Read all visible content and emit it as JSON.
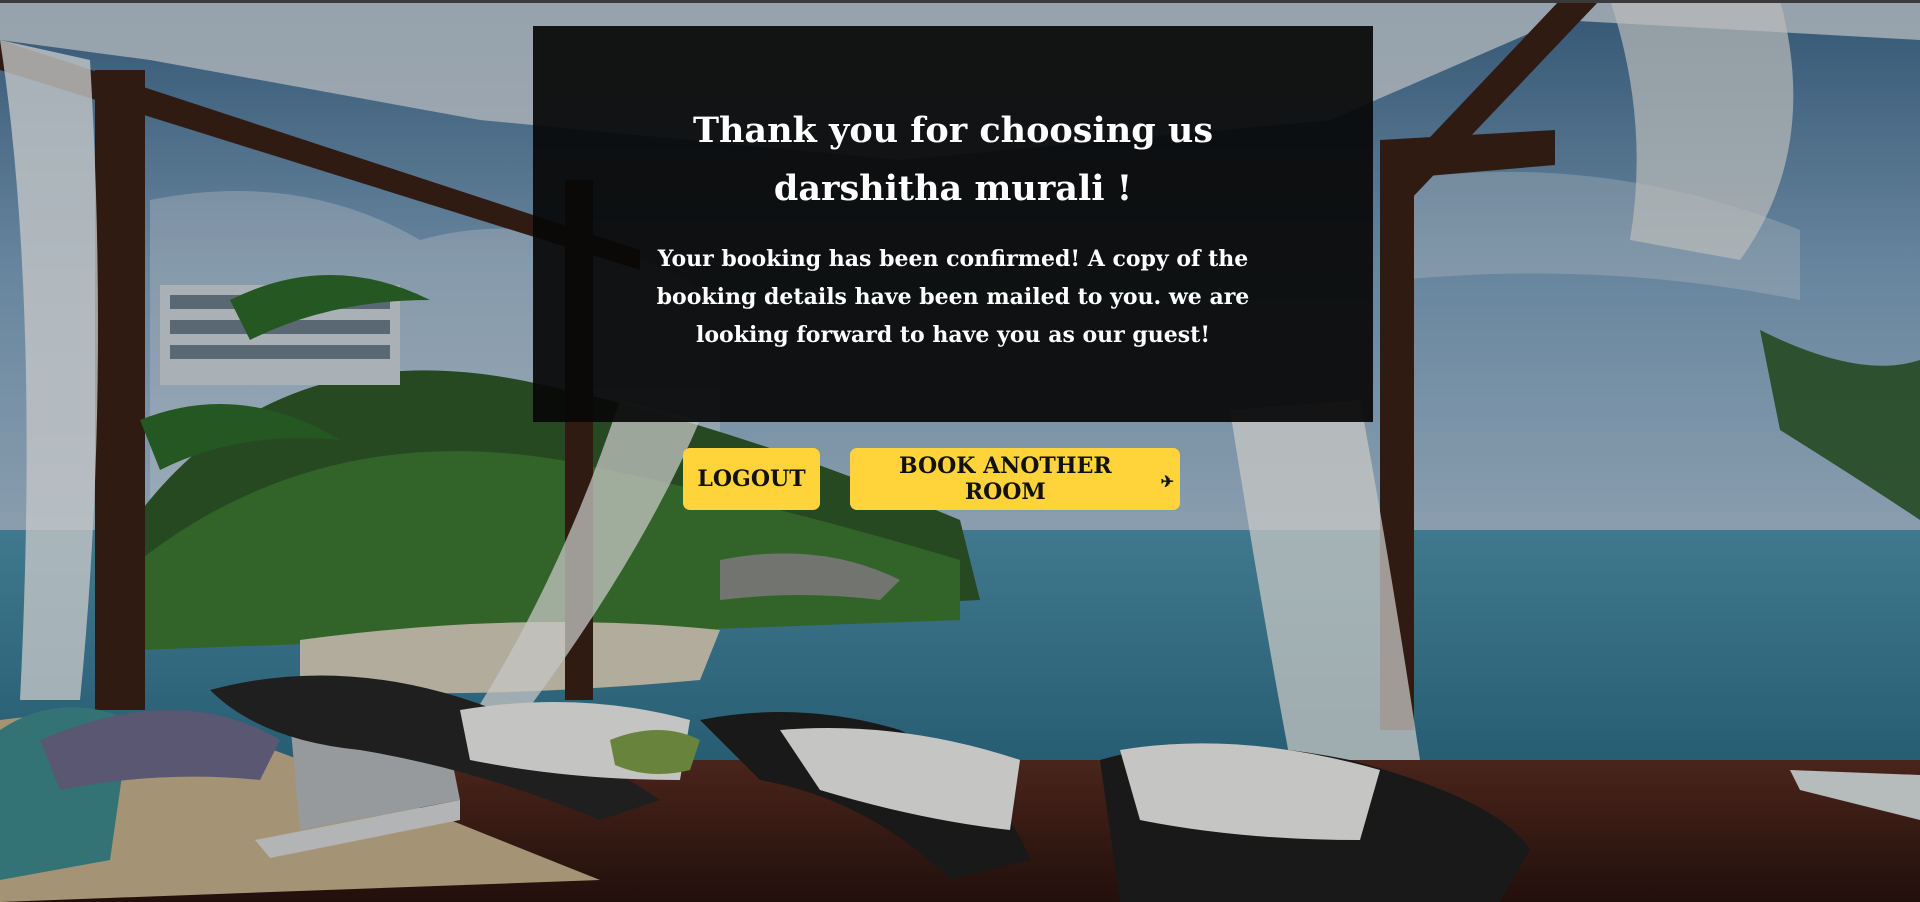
{
  "confirmation": {
    "title": "Thank you for choosing us darshitha murali !",
    "message": "Your booking has been confirmed! A copy of the booking details have been mailed to you. we are looking forward to have you as our guest!"
  },
  "actions": {
    "logout_label": "LOGOUT",
    "book_another_label": "BOOK ANOTHER ROOM",
    "book_another_icon": "airplane-icon"
  },
  "colors": {
    "button_bg": "#ffd43b",
    "panel_bg": "#080808",
    "sea": "#2f7f98",
    "sky": "#6f97b7"
  }
}
